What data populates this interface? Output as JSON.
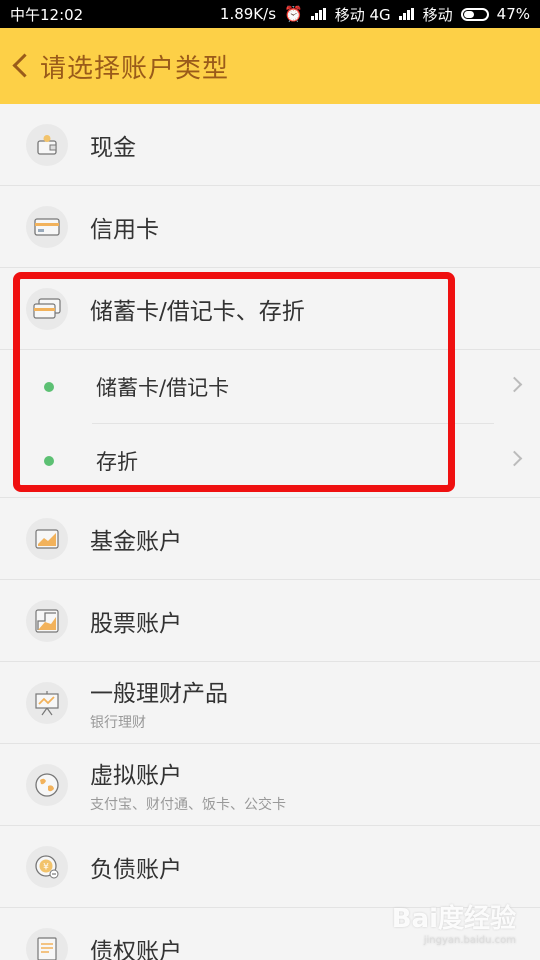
{
  "status": {
    "time": "中午12:02",
    "speed": "1.89K/s",
    "carrier1": "移动 4G",
    "carrier2": "移动",
    "battery": "47%",
    "battery_level": 0.47
  },
  "header": {
    "title": "请选择账户类型"
  },
  "items": [
    {
      "label": "现金",
      "icon": "wallet-icon"
    },
    {
      "label": "信用卡",
      "icon": "credit-card-icon"
    },
    {
      "label": "储蓄卡/借记卡、存折",
      "icon": "debit-cards-icon",
      "children": [
        {
          "label": "储蓄卡/借记卡"
        },
        {
          "label": "存折"
        }
      ]
    },
    {
      "label": "基金账户",
      "icon": "fund-chart-icon"
    },
    {
      "label": "股票账户",
      "icon": "stock-chart-icon"
    },
    {
      "label": "一般理财产品",
      "sub": "银行理财",
      "icon": "presentation-board-icon"
    },
    {
      "label": "虚拟账户",
      "sub": "支付宝、财付通、饭卡、公交卡",
      "icon": "globe-icon"
    },
    {
      "label": "负债账户",
      "icon": "yen-coin-icon"
    },
    {
      "label": "债权账户",
      "icon": "document-icon"
    }
  ],
  "watermark": {
    "text": "Bai度经验",
    "url": "jingyan.baidu.com"
  },
  "colors": {
    "accent": "#fdd047",
    "title": "#9a5b1a",
    "highlight": "#ef1010",
    "dot": "#5cc073"
  }
}
